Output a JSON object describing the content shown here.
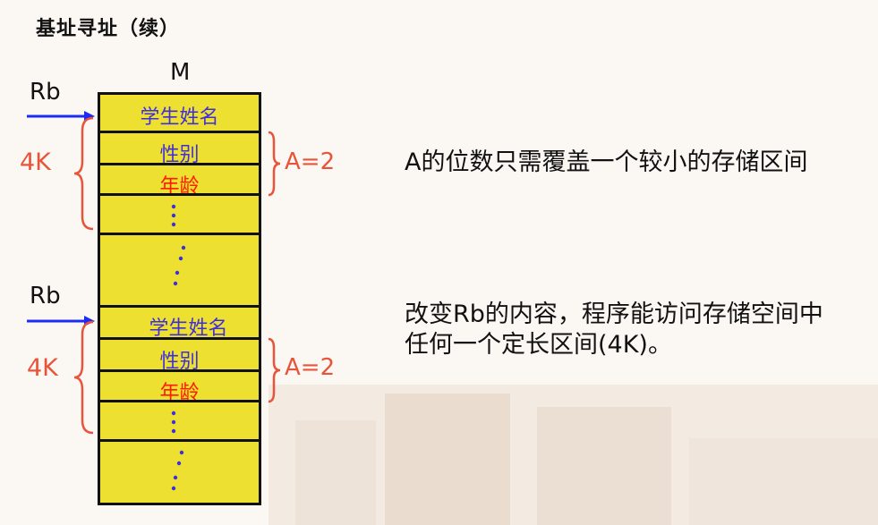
{
  "title": "基址寻址（续）",
  "memory_label": "M",
  "pointer_label": "Rb",
  "size_label": "4K",
  "offset_label": "A=2",
  "fields": {
    "name": "学生姓名",
    "gender": "性别",
    "age": "年龄"
  },
  "description_1": "A的位数只需覆盖一个较小的存储区间",
  "description_2_line1": "改变Rb的内容，程序能访问存储空间中",
  "description_2_line2": "任何一个定长区间(4K)。",
  "colors": {
    "cell_fill": "#ede030",
    "arrow": "#1a2cf5",
    "brace": "#e8543a",
    "field_blue": "#3f2fd8",
    "field_red": "#ff1a00"
  }
}
